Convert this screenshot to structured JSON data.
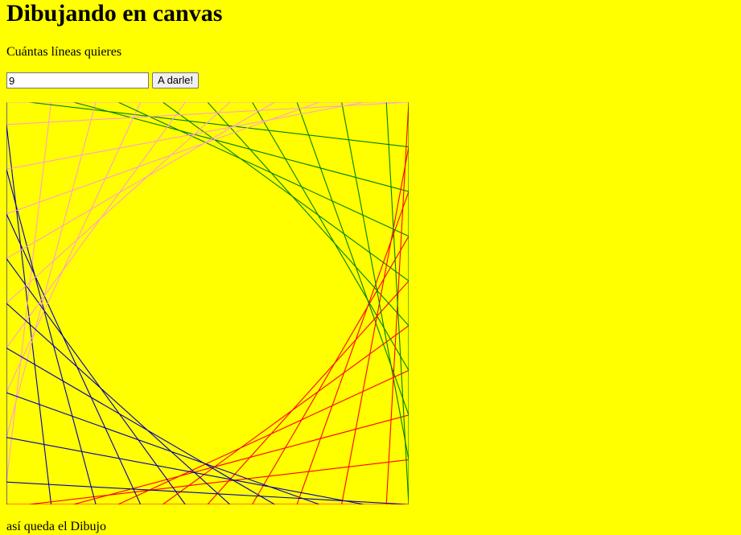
{
  "page": {
    "title": "Dibujando en canvas",
    "prompt": "Cuántas líneas quieres",
    "input_value": "9",
    "button_label": "A darle!",
    "caption": "así queda el Dibujo"
  },
  "drawing": {
    "lines_per_side": 9,
    "colors": {
      "background": "#ffff00",
      "bottom_left": "#0000aa",
      "bottom_right": "#ff0000",
      "top_left": "#ffa0c8",
      "top_right": "#008000"
    }
  }
}
